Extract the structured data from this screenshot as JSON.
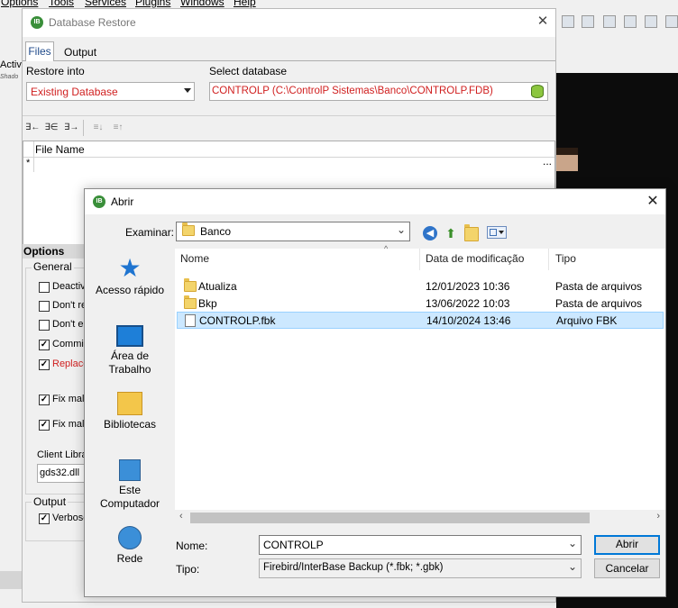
{
  "menubar": {
    "items": [
      "Options",
      "Tools",
      "Services",
      "Plugins",
      "Windows",
      "Help"
    ]
  },
  "background": {
    "left_label": "Activ",
    "left_sub": "Shado"
  },
  "restore": {
    "title": "Database Restore",
    "tabs": [
      "Files",
      "Output"
    ],
    "restore_into_label": "Restore into",
    "restore_into_value": "Existing Database",
    "select_db_label": "Select database",
    "select_db_value": "CONTROLP (C:\\ControlP Sistemas\\Banco\\CONTROLP.FDB)",
    "grid_header": "File Name",
    "grid_new_row": "*",
    "grid_ellipsis": "...",
    "options_header": "Options",
    "general_label": "General",
    "checkboxes": [
      {
        "label": "Deactivate indexes",
        "checked": false
      },
      {
        "label": "Don't recreate shadow files",
        "checked": false
      },
      {
        "label": "Don't enforce validity conditions",
        "checked": false
      },
      {
        "label": "Commit after each table",
        "checked": true
      },
      {
        "label": "Replace existing database",
        "checked": true
      },
      {
        "label": "Fix malformed UNICODE_FSS metadata",
        "checked": true
      },
      {
        "label": "Fix malformed UNICODE_FSS data",
        "checked": true
      }
    ],
    "client_library_label": "Client Library",
    "client_library_value": "gds32.dll",
    "output_label": "Output",
    "verbose_label": "Verbose",
    "verbose_checked": true,
    "accent_red": "#d01f1f"
  },
  "abrir": {
    "title": "Abrir",
    "look_in_label": "Examinar:",
    "look_in_value": "Banco",
    "places": [
      "Acesso rápido",
      "Área de Trabalho",
      "Bibliotecas",
      "Este Computador",
      "Rede"
    ],
    "columns": [
      "Nome",
      "Data de modificação",
      "Tipo"
    ],
    "files": [
      {
        "name": "Atualiza",
        "date": "12/01/2023 10:36",
        "type": "Pasta de arquivos",
        "icon": "folder-icon",
        "selected": false
      },
      {
        "name": "Bkp",
        "date": "13/06/2022 10:03",
        "type": "Pasta de arquivos",
        "icon": "folder-icon",
        "selected": false
      },
      {
        "name": "CONTROLP.fbk",
        "date": "14/10/2024 13:46",
        "type": "Arquivo FBK",
        "icon": "file-icon",
        "selected": true
      }
    ],
    "file_name_label": "Nome:",
    "file_name_value": "CONTROLP",
    "file_type_label": "Tipo:",
    "file_type_value": "Firebird/InterBase Backup (*.fbk; *.gbk)",
    "open_button": "Abrir",
    "cancel_button": "Cancelar",
    "selection_color": "#cce8ff"
  }
}
